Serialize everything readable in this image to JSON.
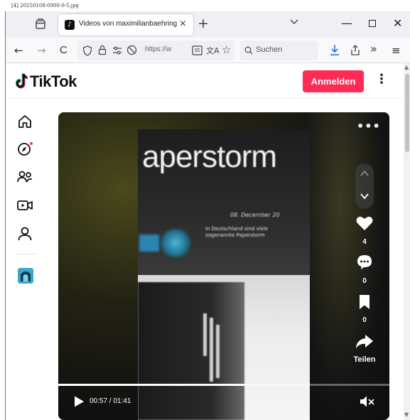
{
  "file_label": "[4] 20250108-0900-0-5.jpg",
  "browser": {
    "tab_title": "Videos von maximilianbaehring",
    "tab_favicon": "tiktok-icon",
    "new_tab_symbol": "+",
    "tab_close_symbol": "×",
    "window_controls": {
      "minimize": "—",
      "close": "✕"
    },
    "nav": {
      "back": "←",
      "forward": "→",
      "reload": "C",
      "url_text": "https://w",
      "search_placeholder": "Suchen",
      "overflow": "»",
      "menu": "≡"
    }
  },
  "tiktok": {
    "logo_text": "TikTok",
    "login_label": "Anmelden",
    "more_label": "⋮",
    "sidebar_icons": [
      "home-icon",
      "explore-icon",
      "following-icon",
      "live-icon",
      "profile-icon",
      "creator-avatar"
    ],
    "explore_has_notification": true,
    "accent_color": "#fe2c55"
  },
  "video": {
    "frame_title": "aperstorm",
    "frame_date": "08. December 20",
    "frame_sub_1": "In Deutschland sind viele",
    "frame_sub_2": "sogenannte Paperstorm",
    "more_label": "•••",
    "likes": "4",
    "comments": "0",
    "saves": "0",
    "share_label": "Teilen",
    "time_display": "00:57 / 01:41",
    "progress_fraction": 0.568
  }
}
